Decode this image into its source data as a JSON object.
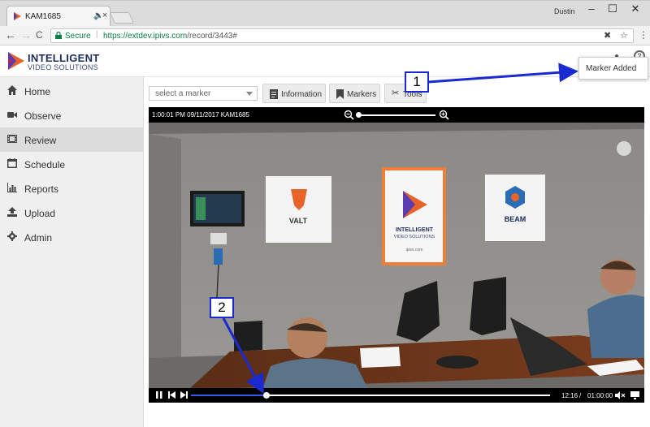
{
  "browser": {
    "tab_title": "KAM1685",
    "tab_audio_icon": "speaker-icon",
    "tab_close": "×",
    "profile_name": "Dustin",
    "window_min": "–",
    "window_max": "☐",
    "window_close": "✕",
    "nav_back": "←",
    "nav_forward": "→",
    "nav_reload": "C",
    "secure_label": "Secure",
    "url_host": "https://extdev.ipivs.com",
    "url_path": "/record/3443#"
  },
  "app": {
    "logo_line1": "INTELLIGENT",
    "logo_line2": "VIDEO SOLUTIONS",
    "header_help": "?"
  },
  "sidebar": {
    "items": [
      {
        "label": "Home",
        "icon": "home-icon"
      },
      {
        "label": "Observe",
        "icon": "video-camera-icon"
      },
      {
        "label": "Review",
        "icon": "film-icon"
      },
      {
        "label": "Schedule",
        "icon": "calendar-icon"
      },
      {
        "label": "Reports",
        "icon": "bar-chart-icon"
      },
      {
        "label": "Upload",
        "icon": "upload-icon"
      },
      {
        "label": "Admin",
        "icon": "gear-icon"
      }
    ],
    "active_index": 2
  },
  "toolbar": {
    "marker_select_placeholder": "select a marker",
    "information_label": "Information",
    "markers_label": "Markers",
    "tools_label": "Tools"
  },
  "video": {
    "timestamp_overlay": "1:00:01 PM 09/11/2017 KAM1685",
    "current_time": "12:16",
    "time_separator": "/",
    "duration": "01:00:00",
    "progress_fraction": 0.2,
    "zoom_fraction": 0.0
  },
  "scene_posters": {
    "valt_title": "VALT",
    "ivs_line1": "INTELLIGENT",
    "ivs_line2": "VIDEO SOLUTIONS",
    "ivs_url": "ipivs.com",
    "beam_title": "BEAM"
  },
  "annotations": {
    "callout_1": "1",
    "callout_2": "2",
    "toast_message": "Marker Added",
    "arrow_color": "#1a2ad0"
  }
}
